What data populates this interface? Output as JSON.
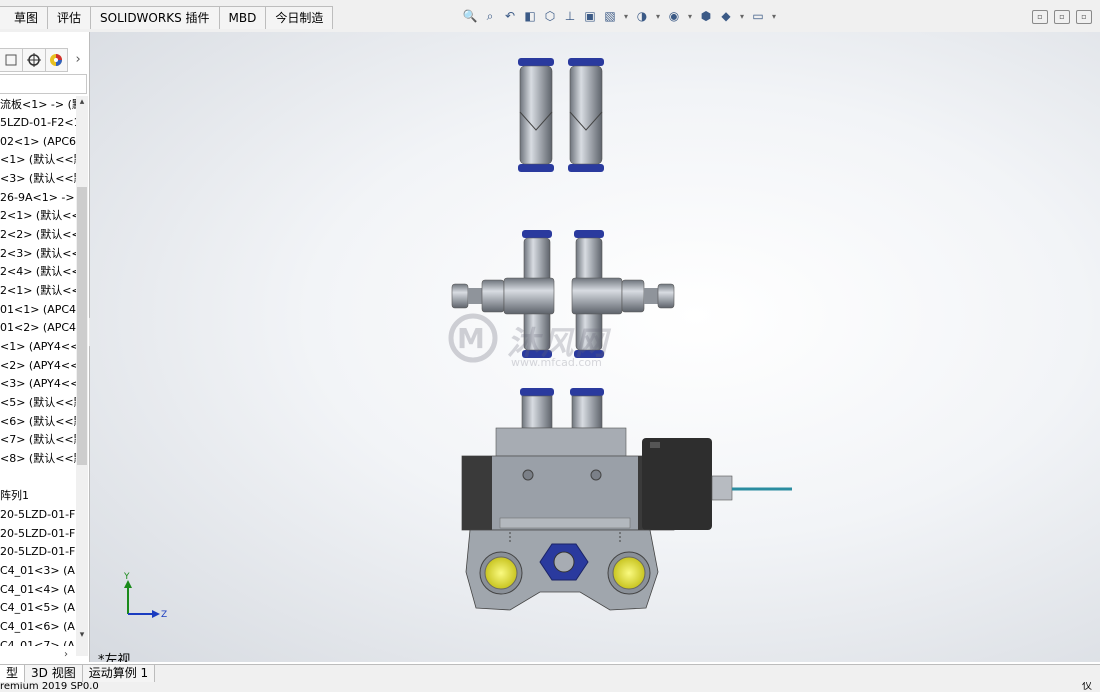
{
  "command_tabs": [
    "草图",
    "评估",
    "SOLIDWORKS 插件",
    "MBD",
    "今日制造"
  ],
  "panel_tabs": {
    "arrow": "›"
  },
  "tree_items": [
    "流板<1> -> (默",
    "5LZD-01-F2<1",
    "02<1> (APC6",
    "<1> (默认<<默",
    "<3> (默认<<默",
    "26-9A<1> ->",
    "2<1> (默认<<",
    "2<2> (默认<<",
    "2<3> (默认<<",
    "2<4> (默认<<",
    "2<1> (默认<<",
    "01<1> (APC4",
    "01<2> (APC4",
    "<1> (APY4<<",
    "<2> (APY4<<",
    "<3> (APY4<<",
    "<5> (默认<<默",
    "<6> (默认<<默",
    "<7> (默认<<默",
    "<8> (默认<<默",
    "",
    "阵列1",
    "20-5LZD-01-F",
    "20-5LZD-01-F",
    "20-5LZD-01-F",
    "C4_01<3> (A",
    "C4_01<4> (A",
    "C4_01<5> (A",
    "C4_01<6> (A",
    "C4_01<7> (A"
  ],
  "viewport": {
    "view_label": "*左视",
    "triad": {
      "y_label": "Y",
      "z_label": "Z"
    },
    "watermark": {
      "text": "沐风网",
      "url": "www.mfcad.com"
    }
  },
  "bottom_tabs": [
    "型",
    "3D 视图",
    "运动算例 1"
  ],
  "status": {
    "left": "remium 2019 SP0.0",
    "right": "仅"
  },
  "colors": {
    "accent": "#2a3a9e",
    "port_yellow": "#e8e63a",
    "body_gray": "#9aa0a8",
    "dark_body": "#3a3a3a"
  }
}
